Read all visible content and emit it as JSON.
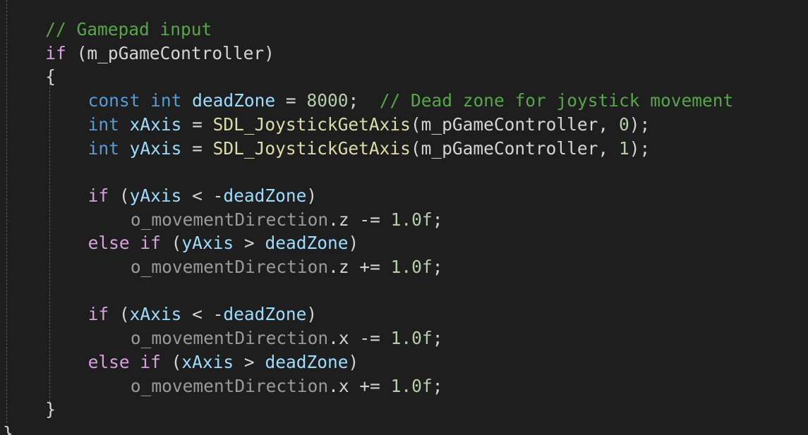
{
  "editor": {
    "lines": [
      {
        "indent": 1,
        "tokens": [
          {
            "t": "// Gamepad input",
            "c": "cm"
          }
        ]
      },
      {
        "indent": 1,
        "tokens": [
          {
            "t": "if",
            "c": "ctl"
          },
          {
            "t": " (",
            "c": "pn"
          },
          {
            "t": "m_pGameController",
            "c": "pn"
          },
          {
            "t": ")",
            "c": "pn"
          }
        ]
      },
      {
        "indent": 1,
        "tokens": [
          {
            "t": "{",
            "c": "pn"
          }
        ]
      },
      {
        "indent": 2,
        "tokens": [
          {
            "t": "const",
            "c": "kw"
          },
          {
            "t": " ",
            "c": "pn"
          },
          {
            "t": "int",
            "c": "kw"
          },
          {
            "t": " ",
            "c": "pn"
          },
          {
            "t": "deadZone",
            "c": "var"
          },
          {
            "t": " = ",
            "c": "pn"
          },
          {
            "t": "8000",
            "c": "num"
          },
          {
            "t": ";  ",
            "c": "pn"
          },
          {
            "t": "// Dead zone for joystick movement",
            "c": "cm"
          }
        ]
      },
      {
        "indent": 2,
        "tokens": [
          {
            "t": "int",
            "c": "kw"
          },
          {
            "t": " ",
            "c": "pn"
          },
          {
            "t": "xAxis",
            "c": "var"
          },
          {
            "t": " = ",
            "c": "pn"
          },
          {
            "t": "SDL_JoystickGetAxis",
            "c": "fn"
          },
          {
            "t": "(m_pGameController, ",
            "c": "pn"
          },
          {
            "t": "0",
            "c": "num"
          },
          {
            "t": ");",
            "c": "pn"
          }
        ]
      },
      {
        "indent": 2,
        "tokens": [
          {
            "t": "int",
            "c": "kw"
          },
          {
            "t": " ",
            "c": "pn"
          },
          {
            "t": "yAxis",
            "c": "var"
          },
          {
            "t": " = ",
            "c": "pn"
          },
          {
            "t": "SDL_JoystickGetAxis",
            "c": "fn"
          },
          {
            "t": "(m_pGameController, ",
            "c": "pn"
          },
          {
            "t": "1",
            "c": "num"
          },
          {
            "t": ");",
            "c": "pn"
          }
        ]
      },
      {
        "indent": 0,
        "tokens": []
      },
      {
        "indent": 2,
        "tokens": [
          {
            "t": "if",
            "c": "ctl"
          },
          {
            "t": " (",
            "c": "pn"
          },
          {
            "t": "yAxis",
            "c": "var"
          },
          {
            "t": " < -",
            "c": "pn"
          },
          {
            "t": "deadZone",
            "c": "var"
          },
          {
            "t": ")",
            "c": "pn"
          }
        ]
      },
      {
        "indent": 3,
        "tokens": [
          {
            "t": "o_movementDirection",
            "c": "mem"
          },
          {
            "t": ".z -= ",
            "c": "pn"
          },
          {
            "t": "1.0f",
            "c": "num"
          },
          {
            "t": ";",
            "c": "pn"
          }
        ]
      },
      {
        "indent": 2,
        "tokens": [
          {
            "t": "else",
            "c": "ctl"
          },
          {
            "t": " ",
            "c": "pn"
          },
          {
            "t": "if",
            "c": "ctl"
          },
          {
            "t": " (",
            "c": "pn"
          },
          {
            "t": "yAxis",
            "c": "var"
          },
          {
            "t": " > ",
            "c": "pn"
          },
          {
            "t": "deadZone",
            "c": "var"
          },
          {
            "t": ")",
            "c": "pn"
          }
        ]
      },
      {
        "indent": 3,
        "tokens": [
          {
            "t": "o_movementDirection",
            "c": "mem"
          },
          {
            "t": ".z += ",
            "c": "pn"
          },
          {
            "t": "1.0f",
            "c": "num"
          },
          {
            "t": ";",
            "c": "pn"
          }
        ]
      },
      {
        "indent": 0,
        "tokens": []
      },
      {
        "indent": 2,
        "tokens": [
          {
            "t": "if",
            "c": "ctl"
          },
          {
            "t": " (",
            "c": "pn"
          },
          {
            "t": "xAxis",
            "c": "var"
          },
          {
            "t": " < -",
            "c": "pn"
          },
          {
            "t": "deadZone",
            "c": "var"
          },
          {
            "t": ")",
            "c": "pn"
          }
        ]
      },
      {
        "indent": 3,
        "tokens": [
          {
            "t": "o_movementDirection",
            "c": "mem"
          },
          {
            "t": ".x -= ",
            "c": "pn"
          },
          {
            "t": "1.0f",
            "c": "num"
          },
          {
            "t": ";",
            "c": "pn"
          }
        ]
      },
      {
        "indent": 2,
        "tokens": [
          {
            "t": "else",
            "c": "ctl"
          },
          {
            "t": " ",
            "c": "pn"
          },
          {
            "t": "if",
            "c": "ctl"
          },
          {
            "t": " (",
            "c": "pn"
          },
          {
            "t": "xAxis",
            "c": "var"
          },
          {
            "t": " > ",
            "c": "pn"
          },
          {
            "t": "deadZone",
            "c": "var"
          },
          {
            "t": ")",
            "c": "pn"
          }
        ]
      },
      {
        "indent": 3,
        "tokens": [
          {
            "t": "o_movementDirection",
            "c": "mem"
          },
          {
            "t": ".x += ",
            "c": "pn"
          },
          {
            "t": "1.0f",
            "c": "num"
          },
          {
            "t": ";",
            "c": "pn"
          }
        ]
      },
      {
        "indent": 1,
        "tokens": [
          {
            "t": "}",
            "c": "pn"
          }
        ]
      },
      {
        "indent": 0,
        "tokens": [
          {
            "t": "}",
            "c": "pn"
          }
        ]
      }
    ]
  },
  "colors": {
    "background": "#1e1e1e",
    "comment": "#57a64a",
    "keyword": "#569cd6",
    "control": "#d8a0df",
    "variable": "#9cdcfe",
    "member": "#9a9a9a",
    "function": "#dcdcaa",
    "number": "#b5cea8",
    "default": "#d4d4d4"
  }
}
